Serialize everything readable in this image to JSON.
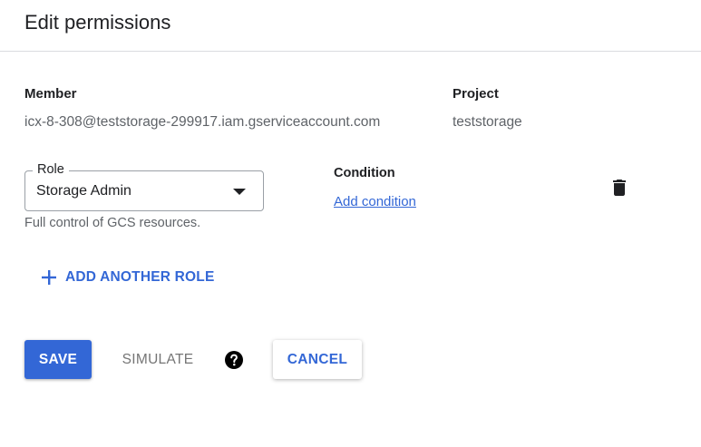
{
  "dialog": {
    "title": "Edit permissions"
  },
  "member": {
    "label": "Member",
    "value": "icx-8-308@teststorage-299917.iam.gserviceaccount.com"
  },
  "project": {
    "label": "Project",
    "value": "teststorage"
  },
  "role": {
    "label": "Role",
    "selected": "Storage Admin",
    "description": "Full control of GCS resources."
  },
  "condition": {
    "label": "Condition",
    "add_link": "Add condition"
  },
  "actions": {
    "add_role": "ADD ANOTHER ROLE",
    "save": "SAVE",
    "simulate": "SIMULATE",
    "cancel": "CANCEL"
  },
  "icons": {
    "delete": "trash-icon",
    "dropdown": "dropdown-arrow-icon",
    "add": "plus-icon",
    "help": "help-icon"
  },
  "colors": {
    "accent": "#3367d6",
    "text_primary": "#202124",
    "text_secondary": "#5f6368",
    "disabled": "#757575"
  }
}
